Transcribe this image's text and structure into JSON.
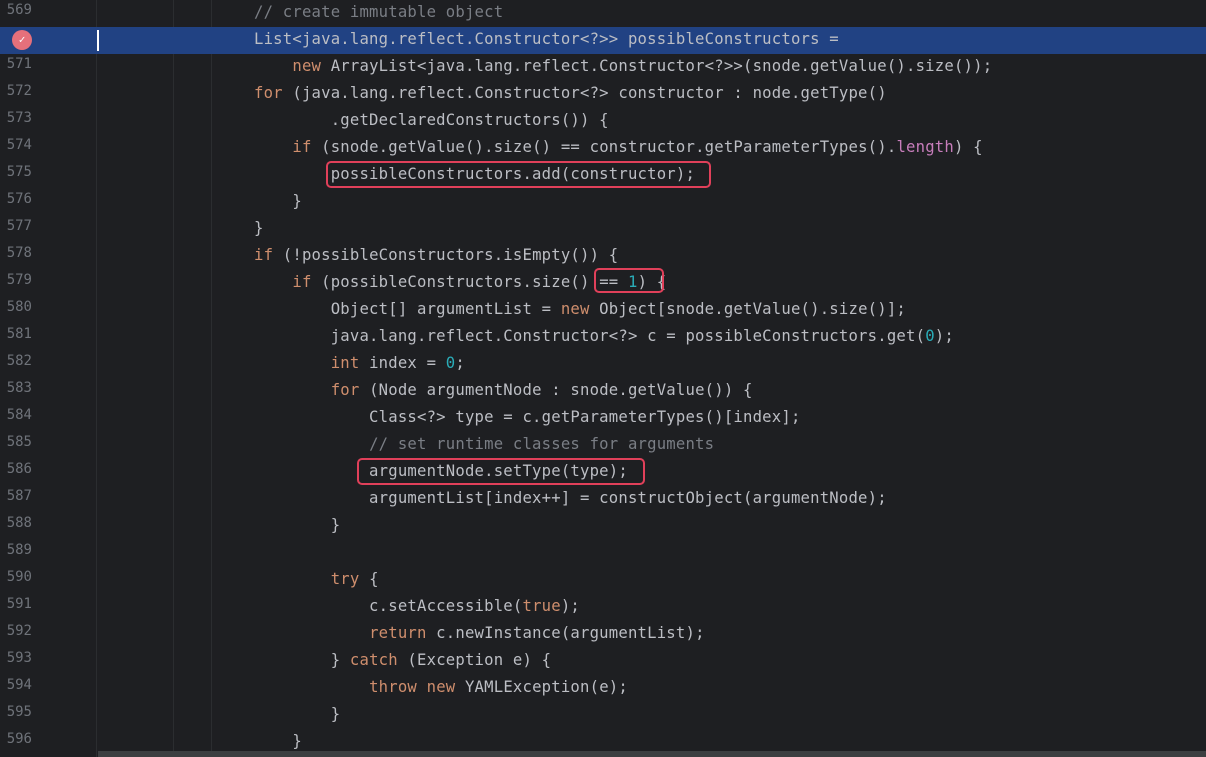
{
  "editor": {
    "lines": [
      {
        "num": "569",
        "tokens": [
          {
            "t": "// create immutable object",
            "c": "cmt"
          }
        ]
      },
      {
        "num": "",
        "tokens": [
          {
            "t": "List<java.lang.reflect.Constructor<?>> possibleConstructors ="
          }
        ]
      },
      {
        "num": "571",
        "tokens": [
          {
            "t": "    "
          },
          {
            "t": "new",
            "c": "kw"
          },
          {
            "t": " ArrayList<java.lang.reflect.Constructor<?>>(snode.getValue().size());"
          }
        ]
      },
      {
        "num": "572",
        "tokens": [
          {
            "t": "for",
            "c": "kw"
          },
          {
            "t": " (java.lang.reflect.Constructor<?> constructor : node.getType()"
          }
        ]
      },
      {
        "num": "573",
        "tokens": [
          {
            "t": "        .getDeclaredConstructors()) {"
          }
        ]
      },
      {
        "num": "574",
        "tokens": [
          {
            "t": "    "
          },
          {
            "t": "if",
            "c": "kw"
          },
          {
            "t": " (snode.getValue().size() == constructor.getParameterTypes()."
          },
          {
            "t": "length",
            "c": "fld"
          },
          {
            "t": ") {"
          }
        ]
      },
      {
        "num": "575",
        "tokens": [
          {
            "t": "        possibleConstructors.add(constructor);"
          }
        ]
      },
      {
        "num": "576",
        "tokens": [
          {
            "t": "    }"
          }
        ]
      },
      {
        "num": "577",
        "tokens": [
          {
            "t": "}"
          }
        ]
      },
      {
        "num": "578",
        "tokens": [
          {
            "t": "if",
            "c": "kw"
          },
          {
            "t": " (!possibleConstructors.isEmpty()) {"
          }
        ]
      },
      {
        "num": "579",
        "tokens": [
          {
            "t": "    "
          },
          {
            "t": "if",
            "c": "kw"
          },
          {
            "t": " (possibleConstructors.size() == "
          },
          {
            "t": "1",
            "c": "num"
          },
          {
            "t": ") {"
          }
        ]
      },
      {
        "num": "580",
        "tokens": [
          {
            "t": "        Object[] argumentList = "
          },
          {
            "t": "new",
            "c": "kw"
          },
          {
            "t": " Object[snode.getValue().size()];"
          }
        ]
      },
      {
        "num": "581",
        "tokens": [
          {
            "t": "        java.lang.reflect.Constructor<?> c = possibleConstructors.get("
          },
          {
            "t": "0",
            "c": "num"
          },
          {
            "t": ");"
          }
        ]
      },
      {
        "num": "582",
        "tokens": [
          {
            "t": "        "
          },
          {
            "t": "int",
            "c": "kw"
          },
          {
            "t": " index = "
          },
          {
            "t": "0",
            "c": "num"
          },
          {
            "t": ";"
          }
        ]
      },
      {
        "num": "583",
        "tokens": [
          {
            "t": "        "
          },
          {
            "t": "for",
            "c": "kw"
          },
          {
            "t": " (Node argumentNode : snode.getValue()) {"
          }
        ]
      },
      {
        "num": "584",
        "tokens": [
          {
            "t": "            Class<?> type = c.getParameterTypes()[index];"
          }
        ]
      },
      {
        "num": "585",
        "tokens": [
          {
            "t": "            "
          },
          {
            "t": "// set runtime classes for arguments",
            "c": "cmt"
          }
        ]
      },
      {
        "num": "586",
        "tokens": [
          {
            "t": "            argumentNode.setType(type);"
          }
        ]
      },
      {
        "num": "587",
        "tokens": [
          {
            "t": "            argumentList[index++] = constructObject(argumentNode);"
          }
        ]
      },
      {
        "num": "588",
        "tokens": [
          {
            "t": "        }"
          }
        ]
      },
      {
        "num": "589",
        "tokens": [
          {
            "t": ""
          }
        ]
      },
      {
        "num": "590",
        "tokens": [
          {
            "t": "        "
          },
          {
            "t": "try",
            "c": "kw"
          },
          {
            "t": " {"
          }
        ]
      },
      {
        "num": "591",
        "tokens": [
          {
            "t": "            c.setAccessible("
          },
          {
            "t": "true",
            "c": "kw"
          },
          {
            "t": ");"
          }
        ]
      },
      {
        "num": "592",
        "tokens": [
          {
            "t": "            "
          },
          {
            "t": "return",
            "c": "kw"
          },
          {
            "t": " c.newInstance(argumentList);"
          }
        ]
      },
      {
        "num": "593",
        "tokens": [
          {
            "t": "        } "
          },
          {
            "t": "catch",
            "c": "kw"
          },
          {
            "t": " (Exception e) {"
          }
        ]
      },
      {
        "num": "594",
        "tokens": [
          {
            "t": "            "
          },
          {
            "t": "throw",
            "c": "kw"
          },
          {
            "t": " "
          },
          {
            "t": "new",
            "c": "kw"
          },
          {
            "t": " YAMLException(e);"
          }
        ]
      },
      {
        "num": "595",
        "tokens": [
          {
            "t": "        }"
          }
        ]
      },
      {
        "num": "596",
        "tokens": [
          {
            "t": "    }"
          }
        ]
      }
    ]
  },
  "colors": {
    "background": "#1e1f22",
    "current_line": "#214283",
    "keyword": "#cf8e6d",
    "number": "#2aacb8",
    "comment": "#7a7e85",
    "field": "#c77dbb",
    "highlight_box": "#e0405a",
    "breakpoint": "#e5707b"
  },
  "icons": {
    "breakpoint": "breakpoint-icon"
  }
}
